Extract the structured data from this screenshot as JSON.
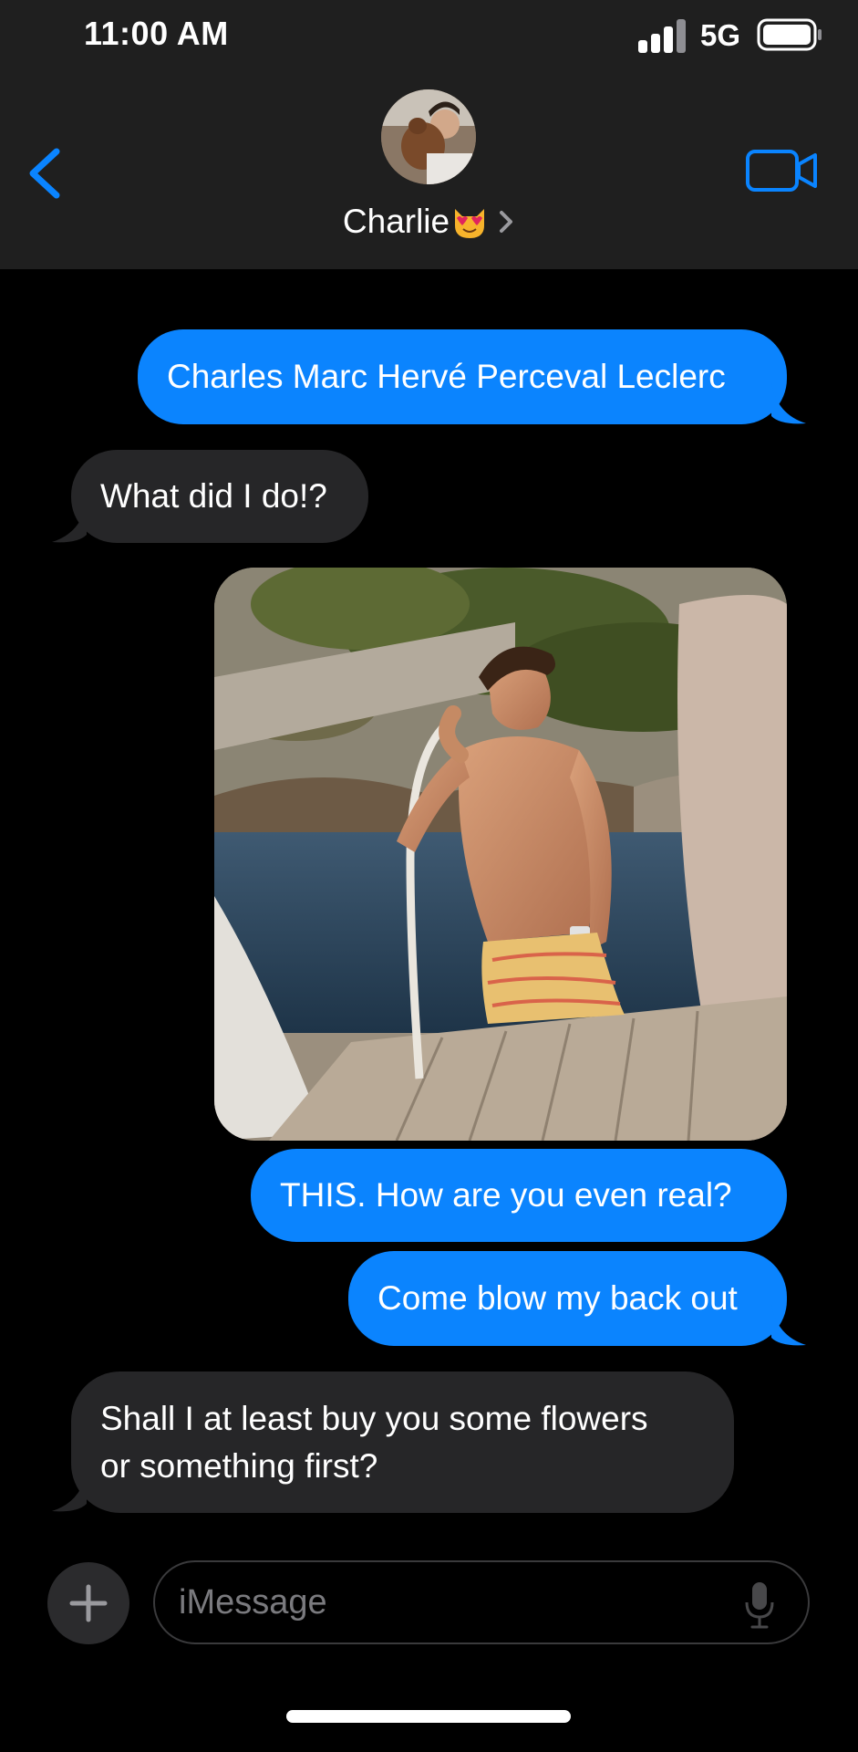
{
  "status_bar": {
    "time": "11:00 AM",
    "network": "5G"
  },
  "header": {
    "contact_name": "Charlie",
    "contact_emoji": "heart-eyes-cat-emoji",
    "back_icon": "chevron-left-icon",
    "video_icon": "video-camera-icon"
  },
  "messages": [
    {
      "side": "sent",
      "text": "Charles Marc Hervé Perceval Leclerc"
    },
    {
      "side": "received",
      "text": "What did I do!?"
    },
    {
      "side": "sent",
      "type": "image",
      "description_icon": "photo-attachment"
    },
    {
      "side": "sent",
      "text": "THIS. How are you even real?"
    },
    {
      "side": "sent",
      "text": "Come blow my back out"
    },
    {
      "side": "received",
      "line1": "Shall I at least buy you some flowers",
      "line2": "or something first?"
    }
  ],
  "composer": {
    "placeholder": "iMessage"
  },
  "colors": {
    "sent_bubble": "#0b84fe",
    "received_bubble": "#262628",
    "accent": "#0a84ff"
  }
}
